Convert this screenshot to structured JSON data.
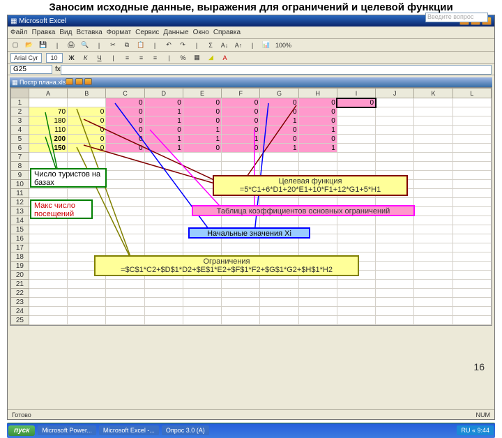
{
  "slide": {
    "title": "Заносим исходные данные, выражения для ограничений и целевой функции",
    "pagenum": "16"
  },
  "app": {
    "title": "Microsoft Excel",
    "typebox": "Введите вопрос"
  },
  "menu": [
    "Файл",
    "Правка",
    "Вид",
    "Вставка",
    "Формат",
    "Сервис",
    "Данные",
    "Окно",
    "Справка"
  ],
  "fmtbar": {
    "font": "Arial Cyr",
    "size": "10"
  },
  "status": {
    "left": "Готово",
    "right": "NUM"
  },
  "namebox": "G25",
  "wb": "Постр плана.xls",
  "cols": [
    "A",
    "B",
    "C",
    "D",
    "E",
    "F",
    "G",
    "H",
    "I",
    "J",
    "K",
    "L"
  ],
  "rows": 25,
  "cells": {
    "r1": {
      "C": "0",
      "D": "0",
      "E": "0",
      "F": "0",
      "G": "0",
      "H": "0",
      "I": "0"
    },
    "r2": {
      "A": "70",
      "B": "0",
      "C": "0",
      "D": "1",
      "E": "0",
      "F": "0",
      "G": "0",
      "H": "0"
    },
    "r3": {
      "A": "180",
      "B": "0",
      "C": "0",
      "D": "1",
      "E": "0",
      "F": "0",
      "G": "1",
      "H": "0"
    },
    "r4": {
      "A": "110",
      "B": "0",
      "C": "0",
      "D": "0",
      "E": "1",
      "F": "0",
      "G": "0",
      "H": "1"
    },
    "r5": {
      "A": "200",
      "B": "0",
      "C": "0",
      "D": "1",
      "E": "1",
      "F": "1",
      "G": "0",
      "H": "0"
    },
    "r6": {
      "A": "150",
      "B": "0",
      "C": "0",
      "D": "1",
      "E": "0",
      "F": "0",
      "G": "1",
      "H": "1"
    }
  },
  "annot": {
    "tourists": "Число туристов на базах",
    "visits": "Макс число посещений",
    "objective_title": "Целевая функция",
    "objective_formula": "=5*C1+6*D1+20*E1+10*F1+12*G1+5*H1",
    "coeff_table": "Таблица коэффициентов основных ограничений",
    "initial_x": "Начальные значения Xi",
    "constraints_title": "Ограничения",
    "constraints_formula": "=$C$1*C2+$D$1*D2+$E$1*E2+$F$1*F2+$G$1*G2+$H$1*H2"
  },
  "taskbar": {
    "start": "пуск",
    "tasks": [
      "Microsoft Power...",
      "Microsoft Excel -...",
      "Опрос 3.0 (А)"
    ],
    "tray": "RU  « 9:44"
  }
}
